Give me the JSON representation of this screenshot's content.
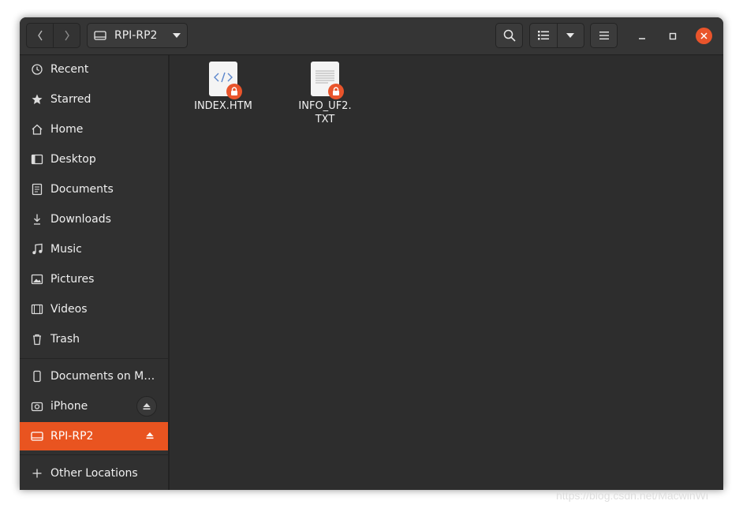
{
  "header": {
    "location_label": "RPI-RP2",
    "back_icon": "chevron-left-icon",
    "forward_icon": "chevron-right-icon",
    "search_icon": "search-icon",
    "view_icon": "list-view-icon",
    "menu_icon": "hamburger-menu-icon"
  },
  "sidebar": {
    "places": [
      {
        "label": "Recent",
        "icon": "clock-icon"
      },
      {
        "label": "Starred",
        "icon": "star-icon"
      },
      {
        "label": "Home",
        "icon": "home-icon"
      },
      {
        "label": "Desktop",
        "icon": "desktop-icon"
      },
      {
        "label": "Documents",
        "icon": "document-icon"
      },
      {
        "label": "Downloads",
        "icon": "download-icon"
      },
      {
        "label": "Music",
        "icon": "music-icon"
      },
      {
        "label": "Pictures",
        "icon": "picture-icon"
      },
      {
        "label": "Videos",
        "icon": "video-icon"
      },
      {
        "label": "Trash",
        "icon": "trash-icon"
      }
    ],
    "devices": [
      {
        "label": "Documents on Mi…",
        "icon": "phone-icon"
      },
      {
        "label": "iPhone",
        "icon": "camera-icon"
      },
      {
        "label": "RPI-RP2",
        "icon": "drive-icon"
      }
    ],
    "other_locations": "Other Locations"
  },
  "files": [
    {
      "name": "INDEX.HTM",
      "type": "html"
    },
    {
      "name_line1": "INFO_UF2.",
      "name_line2": "TXT",
      "type": "text"
    }
  ],
  "colors": {
    "accent": "#e95420",
    "window_bg": "#2d2d2d",
    "sidebar_bg": "#303030"
  },
  "watermark": "https://blog.csdn.net/MacwinWi"
}
